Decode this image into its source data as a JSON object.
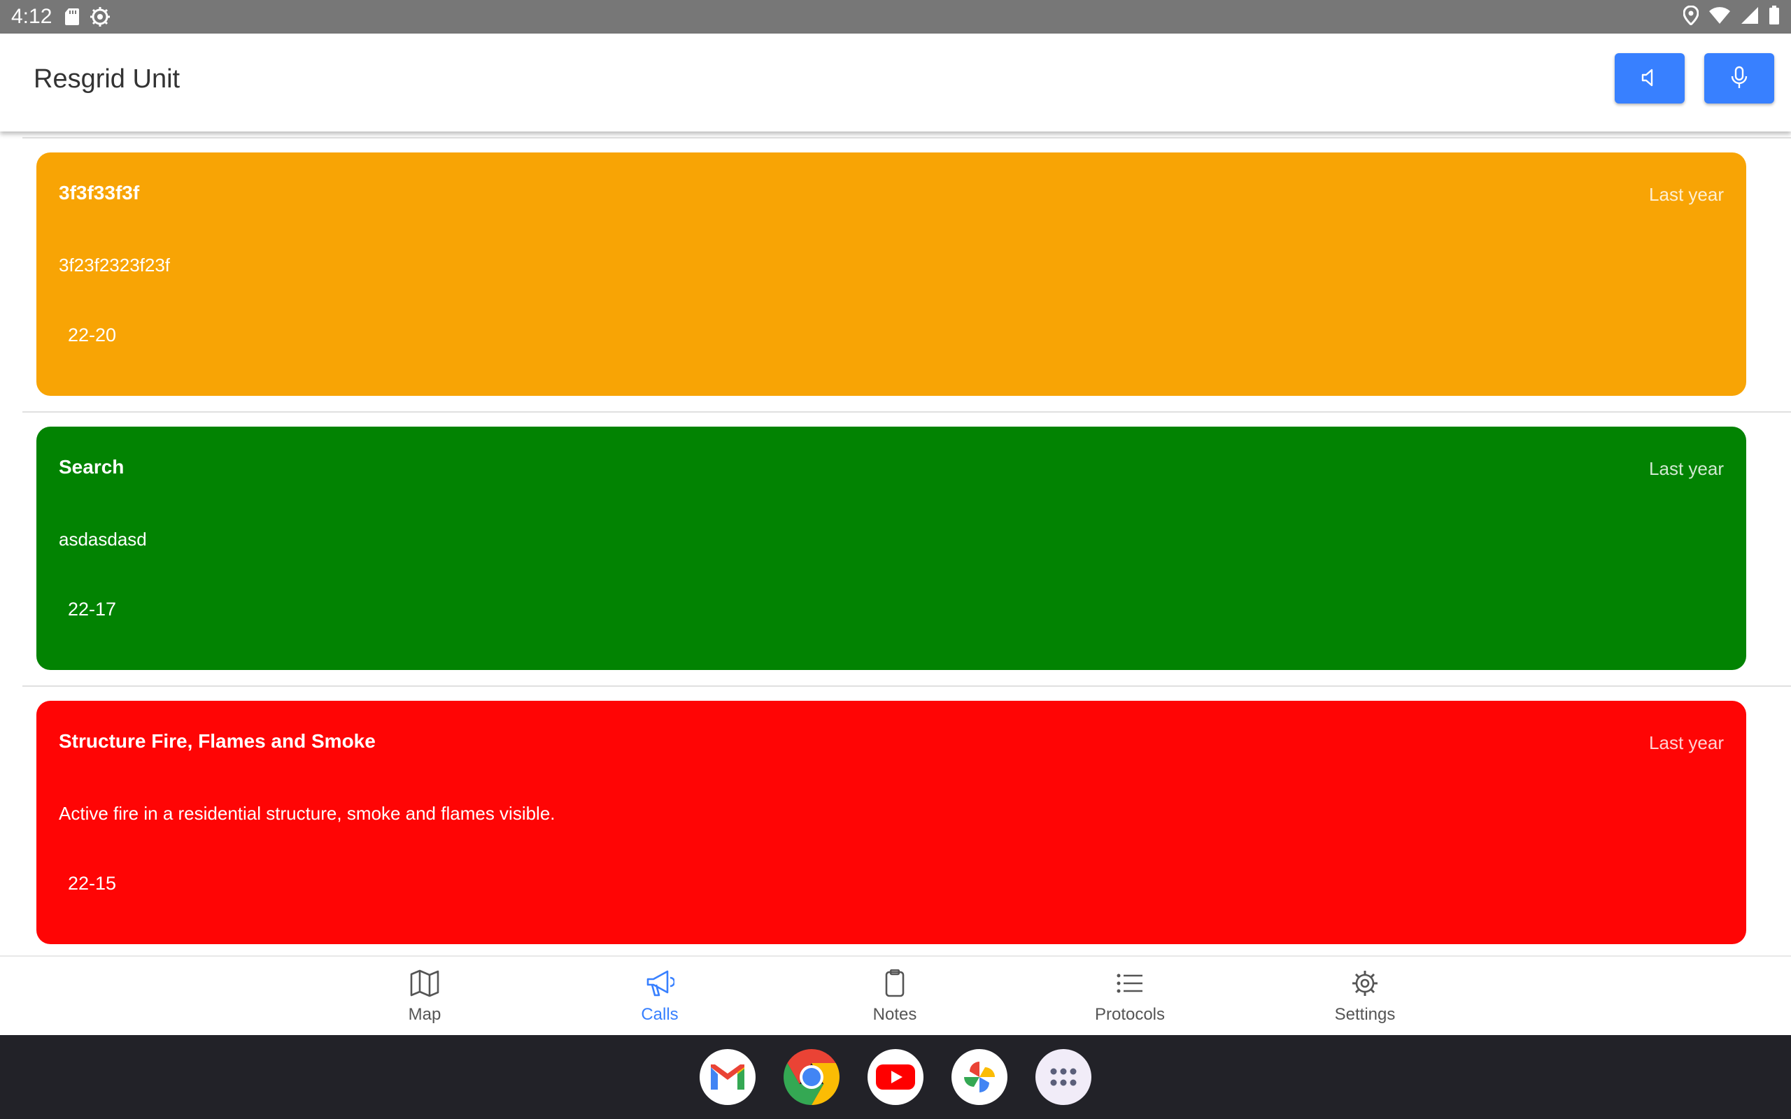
{
  "status_bar": {
    "time": "4:12"
  },
  "app_bar": {
    "title": "Resgrid Unit"
  },
  "calls": [
    {
      "name": "3f3f33f3f",
      "time": "Last year",
      "description": "3f23f2323f23f",
      "number": "22-20",
      "color": "#f8a405"
    },
    {
      "name": "Search",
      "time": "Last year",
      "description": "asdasdasd",
      "number": "22-17",
      "color": "#028302"
    },
    {
      "name": "Structure Fire, Flames and Smoke",
      "time": "Last year",
      "description": "Active fire in a residential structure, smoke and flames visible.",
      "number": "22-15",
      "color": "#ff0505"
    }
  ],
  "tabs": [
    {
      "label": "Map",
      "icon": "map-icon"
    },
    {
      "label": "Calls",
      "icon": "megaphone-icon",
      "active": true
    },
    {
      "label": "Notes",
      "icon": "clipboard-icon"
    },
    {
      "label": "Protocols",
      "icon": "list-icon"
    },
    {
      "label": "Settings",
      "icon": "gear-icon"
    }
  ],
  "dock": {
    "apps": [
      "gmail",
      "chrome",
      "youtube",
      "photos",
      "app-drawer"
    ]
  },
  "colors": {
    "accent": "#3880ff",
    "status_bar": "#777777",
    "dock": "#222228"
  }
}
